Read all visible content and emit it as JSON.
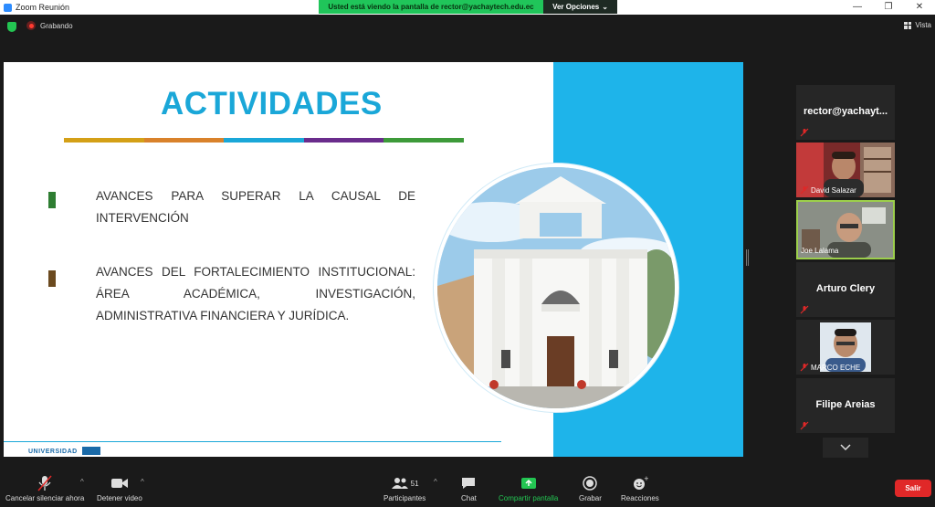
{
  "window": {
    "title": "Zoom Reunión",
    "share_banner": "Usted está viendo la pantalla de rector@yachaytech.edu.ec",
    "view_options": "Ver Opciones",
    "minimize": "—",
    "maximize": "❐",
    "close": "✕"
  },
  "meeting": {
    "recording_label": "Grabando",
    "view_label": "Vista"
  },
  "slide": {
    "title": "ACTIVIDADES",
    "colorbar": [
      "#d4a017",
      "#d9822b",
      "#1aa7d8",
      "#6a2c8c",
      "#3d9a3a"
    ],
    "bullets": [
      {
        "text": "AVANCES PARA SUPERAR LA CAUSAL DE INTERVENCIÓN",
        "color": "#2e7d32"
      },
      {
        "text": "AVANCES DEL FORTALECIMIENTO INSTITUCIONAL: ÁREA ACADÉMICA, INVESTIGACIÓN, ADMINISTRATIVA FINANCIERA Y JURÍDICA.",
        "color": "#6b4a1f"
      }
    ],
    "footer_logo": "UNIVERSIDAD"
  },
  "participants": [
    {
      "name": "rector@yachayt...",
      "type": "name",
      "muted": true
    },
    {
      "name": "David Salazar",
      "type": "video",
      "muted": true
    },
    {
      "name": "Joe Lalama",
      "type": "video",
      "muted": false,
      "active": true
    },
    {
      "name": "Arturo Clery",
      "type": "name",
      "muted": true
    },
    {
      "name": "MARCO ECHE",
      "type": "video",
      "muted": true
    },
    {
      "name": "Filipe Areias",
      "type": "name",
      "muted": true
    }
  ],
  "toolbar": {
    "unmute": "Cancelar silenciar ahora",
    "stop_video": "Detener video",
    "participants": "Participantes",
    "participants_count": "51",
    "chat": "Chat",
    "share_screen": "Compartir pantalla",
    "record": "Grabar",
    "reactions": "Reacciones",
    "leave": "Salir"
  },
  "colors": {
    "accent_blue": "#1aa7d8",
    "share_green": "#23c552",
    "leave_red": "#e02828"
  }
}
